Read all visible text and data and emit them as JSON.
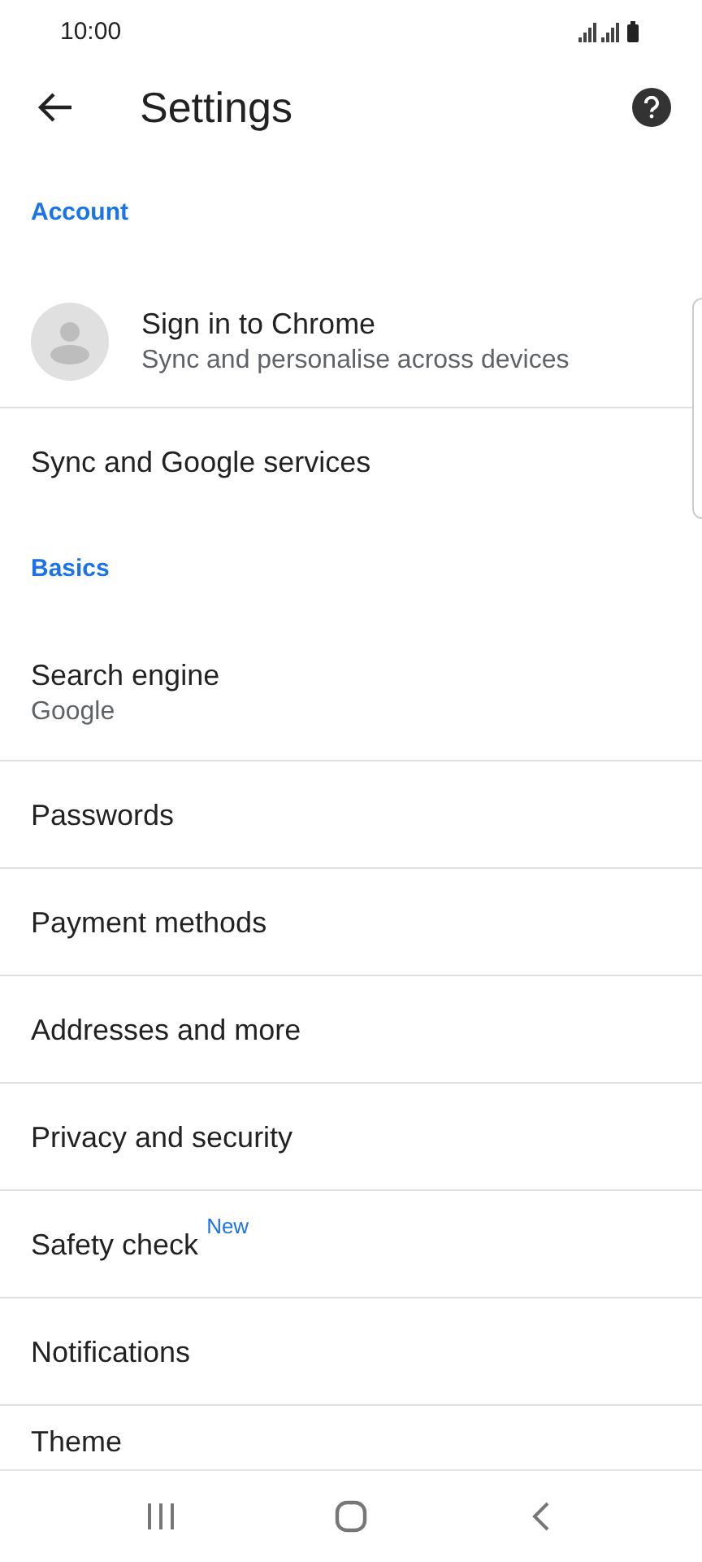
{
  "status_bar": {
    "time": "10:00"
  },
  "toolbar": {
    "title": "Settings"
  },
  "rows": [
    {
      "kind": "header",
      "label": "Account"
    },
    {
      "kind": "account",
      "label": "Sign in to Chrome",
      "subtitle": "Sync and personalise across devices"
    },
    {
      "kind": "item",
      "label": "Sync and Google services"
    },
    {
      "kind": "header",
      "label": "Basics"
    },
    {
      "kind": "item",
      "label": "Search engine",
      "subtitle": "Google"
    },
    {
      "kind": "item",
      "label": "Passwords"
    },
    {
      "kind": "item",
      "label": "Payment methods"
    },
    {
      "kind": "item",
      "label": "Addresses and more"
    },
    {
      "kind": "item",
      "label": "Privacy and security"
    },
    {
      "kind": "item",
      "label": "Safety check",
      "badge": "New"
    },
    {
      "kind": "item",
      "label": "Notifications"
    },
    {
      "kind": "item",
      "label": "Theme"
    }
  ]
}
